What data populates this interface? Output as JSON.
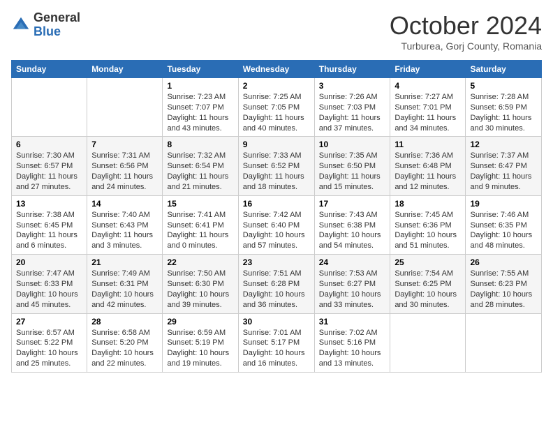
{
  "logo": {
    "general": "General",
    "blue": "Blue"
  },
  "title": "October 2024",
  "subtitle": "Turburea, Gorj County, Romania",
  "days_header": [
    "Sunday",
    "Monday",
    "Tuesday",
    "Wednesday",
    "Thursday",
    "Friday",
    "Saturday"
  ],
  "weeks": [
    [
      {
        "num": "",
        "sunrise": "",
        "sunset": "",
        "daylight": ""
      },
      {
        "num": "",
        "sunrise": "",
        "sunset": "",
        "daylight": ""
      },
      {
        "num": "1",
        "sunrise": "Sunrise: 7:23 AM",
        "sunset": "Sunset: 7:07 PM",
        "daylight": "Daylight: 11 hours and 43 minutes."
      },
      {
        "num": "2",
        "sunrise": "Sunrise: 7:25 AM",
        "sunset": "Sunset: 7:05 PM",
        "daylight": "Daylight: 11 hours and 40 minutes."
      },
      {
        "num": "3",
        "sunrise": "Sunrise: 7:26 AM",
        "sunset": "Sunset: 7:03 PM",
        "daylight": "Daylight: 11 hours and 37 minutes."
      },
      {
        "num": "4",
        "sunrise": "Sunrise: 7:27 AM",
        "sunset": "Sunset: 7:01 PM",
        "daylight": "Daylight: 11 hours and 34 minutes."
      },
      {
        "num": "5",
        "sunrise": "Sunrise: 7:28 AM",
        "sunset": "Sunset: 6:59 PM",
        "daylight": "Daylight: 11 hours and 30 minutes."
      }
    ],
    [
      {
        "num": "6",
        "sunrise": "Sunrise: 7:30 AM",
        "sunset": "Sunset: 6:57 PM",
        "daylight": "Daylight: 11 hours and 27 minutes."
      },
      {
        "num": "7",
        "sunrise": "Sunrise: 7:31 AM",
        "sunset": "Sunset: 6:56 PM",
        "daylight": "Daylight: 11 hours and 24 minutes."
      },
      {
        "num": "8",
        "sunrise": "Sunrise: 7:32 AM",
        "sunset": "Sunset: 6:54 PM",
        "daylight": "Daylight: 11 hours and 21 minutes."
      },
      {
        "num": "9",
        "sunrise": "Sunrise: 7:33 AM",
        "sunset": "Sunset: 6:52 PM",
        "daylight": "Daylight: 11 hours and 18 minutes."
      },
      {
        "num": "10",
        "sunrise": "Sunrise: 7:35 AM",
        "sunset": "Sunset: 6:50 PM",
        "daylight": "Daylight: 11 hours and 15 minutes."
      },
      {
        "num": "11",
        "sunrise": "Sunrise: 7:36 AM",
        "sunset": "Sunset: 6:48 PM",
        "daylight": "Daylight: 11 hours and 12 minutes."
      },
      {
        "num": "12",
        "sunrise": "Sunrise: 7:37 AM",
        "sunset": "Sunset: 6:47 PM",
        "daylight": "Daylight: 11 hours and 9 minutes."
      }
    ],
    [
      {
        "num": "13",
        "sunrise": "Sunrise: 7:38 AM",
        "sunset": "Sunset: 6:45 PM",
        "daylight": "Daylight: 11 hours and 6 minutes."
      },
      {
        "num": "14",
        "sunrise": "Sunrise: 7:40 AM",
        "sunset": "Sunset: 6:43 PM",
        "daylight": "Daylight: 11 hours and 3 minutes."
      },
      {
        "num": "15",
        "sunrise": "Sunrise: 7:41 AM",
        "sunset": "Sunset: 6:41 PM",
        "daylight": "Daylight: 11 hours and 0 minutes."
      },
      {
        "num": "16",
        "sunrise": "Sunrise: 7:42 AM",
        "sunset": "Sunset: 6:40 PM",
        "daylight": "Daylight: 10 hours and 57 minutes."
      },
      {
        "num": "17",
        "sunrise": "Sunrise: 7:43 AM",
        "sunset": "Sunset: 6:38 PM",
        "daylight": "Daylight: 10 hours and 54 minutes."
      },
      {
        "num": "18",
        "sunrise": "Sunrise: 7:45 AM",
        "sunset": "Sunset: 6:36 PM",
        "daylight": "Daylight: 10 hours and 51 minutes."
      },
      {
        "num": "19",
        "sunrise": "Sunrise: 7:46 AM",
        "sunset": "Sunset: 6:35 PM",
        "daylight": "Daylight: 10 hours and 48 minutes."
      }
    ],
    [
      {
        "num": "20",
        "sunrise": "Sunrise: 7:47 AM",
        "sunset": "Sunset: 6:33 PM",
        "daylight": "Daylight: 10 hours and 45 minutes."
      },
      {
        "num": "21",
        "sunrise": "Sunrise: 7:49 AM",
        "sunset": "Sunset: 6:31 PM",
        "daylight": "Daylight: 10 hours and 42 minutes."
      },
      {
        "num": "22",
        "sunrise": "Sunrise: 7:50 AM",
        "sunset": "Sunset: 6:30 PM",
        "daylight": "Daylight: 10 hours and 39 minutes."
      },
      {
        "num": "23",
        "sunrise": "Sunrise: 7:51 AM",
        "sunset": "Sunset: 6:28 PM",
        "daylight": "Daylight: 10 hours and 36 minutes."
      },
      {
        "num": "24",
        "sunrise": "Sunrise: 7:53 AM",
        "sunset": "Sunset: 6:27 PM",
        "daylight": "Daylight: 10 hours and 33 minutes."
      },
      {
        "num": "25",
        "sunrise": "Sunrise: 7:54 AM",
        "sunset": "Sunset: 6:25 PM",
        "daylight": "Daylight: 10 hours and 30 minutes."
      },
      {
        "num": "26",
        "sunrise": "Sunrise: 7:55 AM",
        "sunset": "Sunset: 6:23 PM",
        "daylight": "Daylight: 10 hours and 28 minutes."
      }
    ],
    [
      {
        "num": "27",
        "sunrise": "Sunrise: 6:57 AM",
        "sunset": "Sunset: 5:22 PM",
        "daylight": "Daylight: 10 hours and 25 minutes."
      },
      {
        "num": "28",
        "sunrise": "Sunrise: 6:58 AM",
        "sunset": "Sunset: 5:20 PM",
        "daylight": "Daylight: 10 hours and 22 minutes."
      },
      {
        "num": "29",
        "sunrise": "Sunrise: 6:59 AM",
        "sunset": "Sunset: 5:19 PM",
        "daylight": "Daylight: 10 hours and 19 minutes."
      },
      {
        "num": "30",
        "sunrise": "Sunrise: 7:01 AM",
        "sunset": "Sunset: 5:17 PM",
        "daylight": "Daylight: 10 hours and 16 minutes."
      },
      {
        "num": "31",
        "sunrise": "Sunrise: 7:02 AM",
        "sunset": "Sunset: 5:16 PM",
        "daylight": "Daylight: 10 hours and 13 minutes."
      },
      {
        "num": "",
        "sunrise": "",
        "sunset": "",
        "daylight": ""
      },
      {
        "num": "",
        "sunrise": "",
        "sunset": "",
        "daylight": ""
      }
    ]
  ]
}
